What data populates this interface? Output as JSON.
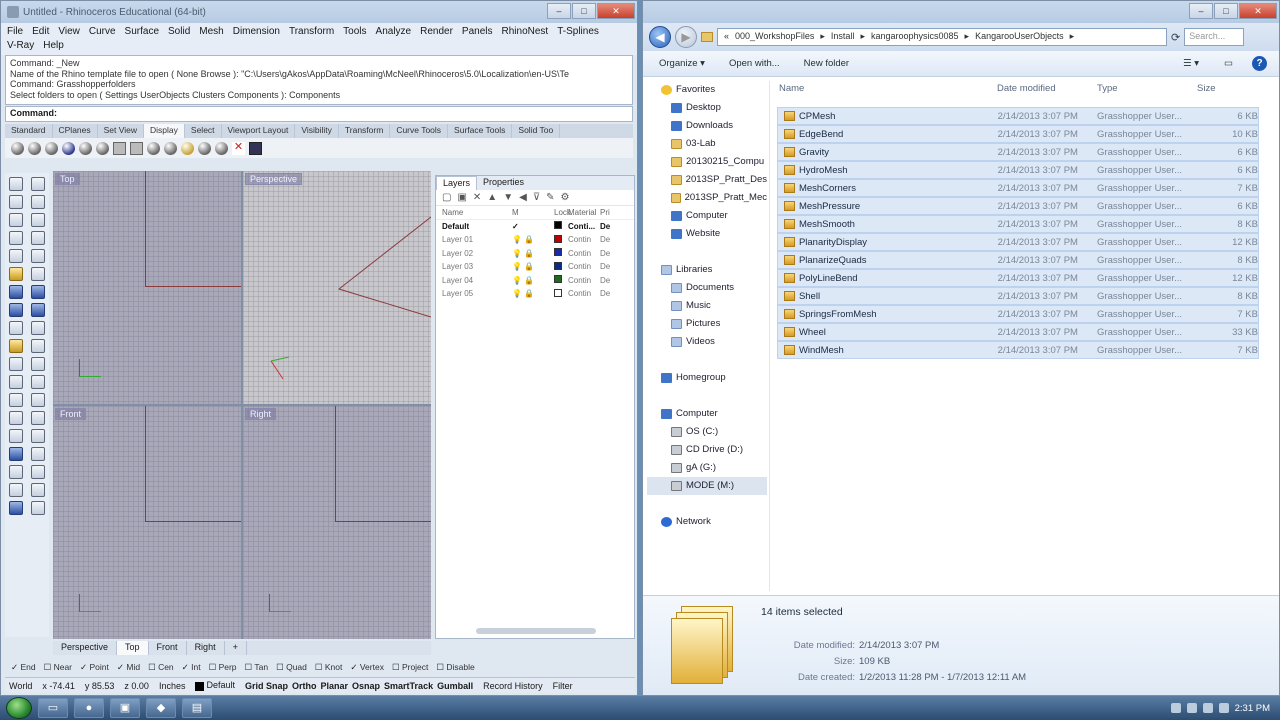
{
  "rhino": {
    "title": "Untitled - Rhinoceros Educational (64-bit)",
    "menu": [
      "File",
      "Edit",
      "View",
      "Curve",
      "Surface",
      "Solid",
      "Mesh",
      "Dimension",
      "Transform",
      "Tools",
      "Analyze",
      "Render",
      "Panels",
      "RhinoNest",
      "T-Splines",
      "V-Ray",
      "Help"
    ],
    "command_history": [
      "Command: _New",
      "Name of the Rhino template file to open ( None  Browse ): \"C:\\Users\\gAkos\\AppData\\Roaming\\McNeel\\Rhinoceros\\5.0\\Localization\\en-US\\Te",
      "Command: Grasshopperfolders",
      "Select folders to open ( Settings  UserObjects  Clusters  Components ): Components"
    ],
    "command_prompt": "Command:",
    "toolbar_tabs": [
      "Standard",
      "CPlanes",
      "Set View",
      "Display",
      "Select",
      "Viewport Layout",
      "Visibility",
      "Transform",
      "Curve Tools",
      "Surface Tools",
      "Solid Too"
    ],
    "active_toolbar_tab": "Display",
    "viewports": [
      {
        "label": "Top"
      },
      {
        "label": "Perspective"
      },
      {
        "label": "Front"
      },
      {
        "label": "Right"
      }
    ],
    "viewport_tabs": [
      "Perspective",
      "Top",
      "Front",
      "Right",
      "+"
    ],
    "layers_panel": {
      "tabs": [
        "Layers",
        "Properties"
      ],
      "headers": [
        "Name",
        "M",
        "Lock",
        "Material",
        "Pri"
      ],
      "rows": [
        {
          "name": "Default",
          "check": "✓",
          "color": "#000000",
          "material": "Conti...",
          "print": "De"
        },
        {
          "name": "Layer 01",
          "check": "",
          "color": "#c00000",
          "material": "Contin",
          "print": "De"
        },
        {
          "name": "Layer 02",
          "check": "",
          "color": "#1a2aa8",
          "material": "Contin",
          "print": "De"
        },
        {
          "name": "Layer 03",
          "check": "",
          "color": "#0a2a8a",
          "material": "Contin",
          "print": "De"
        },
        {
          "name": "Layer 04",
          "check": "",
          "color": "#1e6a1e",
          "material": "Contin",
          "print": "De"
        },
        {
          "name": "Layer 05",
          "check": "",
          "color": "#ffffff",
          "material": "Contin",
          "print": "De"
        }
      ]
    },
    "osnaps": [
      {
        "label": "End",
        "on": true
      },
      {
        "label": "Near",
        "on": false
      },
      {
        "label": "Point",
        "on": true
      },
      {
        "label": "Mid",
        "on": true
      },
      {
        "label": "Cen",
        "on": false
      },
      {
        "label": "Int",
        "on": true
      },
      {
        "label": "Perp",
        "on": false
      },
      {
        "label": "Tan",
        "on": false
      },
      {
        "label": "Quad",
        "on": false
      },
      {
        "label": "Knot",
        "on": false
      },
      {
        "label": "Vertex",
        "on": true
      },
      {
        "label": "Project",
        "on": false
      },
      {
        "label": "Disable",
        "on": false
      }
    ],
    "status": {
      "cplane": "World",
      "x": "x -74.41",
      "y": "y 85.53",
      "z": "z 0.00",
      "units": "Inches",
      "layer": "Default",
      "toggles": [
        "Grid Snap",
        "Ortho",
        "Planar",
        "Osnap",
        "SmartTrack",
        "Gumball"
      ],
      "history": "Record History",
      "filter": "Filter"
    }
  },
  "explorer": {
    "breadcrumb": [
      "000_WorkshopFiles",
      "Install",
      "kangaroophysics0085",
      "KangarooUserObjects"
    ],
    "search_placeholder": "Search...",
    "commands": [
      "Organize ▾",
      "Open with...",
      "New folder"
    ],
    "nav": {
      "favorites": [
        "Favorites",
        "Desktop",
        "Downloads",
        "03-Lab",
        "20130215_Compu",
        "2013SP_Pratt_Des",
        "2013SP_Pratt_Mec",
        "Computer",
        "Website"
      ],
      "libraries": [
        "Libraries",
        "Documents",
        "Music",
        "Pictures",
        "Videos"
      ],
      "homegroup": "Homegroup",
      "computer": [
        "Computer",
        "OS (C:)",
        "CD Drive (D:)",
        "gA (G:)",
        "MODE (M:)"
      ],
      "network": "Network"
    },
    "columns": [
      "Name",
      "Date modified",
      "Type",
      "Size"
    ],
    "files": [
      {
        "name": "CPMesh",
        "date": "2/14/2013 3:07 PM",
        "type": "Grasshopper User...",
        "size": "6 KB"
      },
      {
        "name": "EdgeBend",
        "date": "2/14/2013 3:07 PM",
        "type": "Grasshopper User...",
        "size": "10 KB"
      },
      {
        "name": "Gravity",
        "date": "2/14/2013 3:07 PM",
        "type": "Grasshopper User...",
        "size": "6 KB"
      },
      {
        "name": "HydroMesh",
        "date": "2/14/2013 3:07 PM",
        "type": "Grasshopper User...",
        "size": "6 KB"
      },
      {
        "name": "MeshCorners",
        "date": "2/14/2013 3:07 PM",
        "type": "Grasshopper User...",
        "size": "7 KB"
      },
      {
        "name": "MeshPressure",
        "date": "2/14/2013 3:07 PM",
        "type": "Grasshopper User...",
        "size": "6 KB"
      },
      {
        "name": "MeshSmooth",
        "date": "2/14/2013 3:07 PM",
        "type": "Grasshopper User...",
        "size": "8 KB"
      },
      {
        "name": "PlanarityDisplay",
        "date": "2/14/2013 3:07 PM",
        "type": "Grasshopper User...",
        "size": "12 KB"
      },
      {
        "name": "PlanarizeQuads",
        "date": "2/14/2013 3:07 PM",
        "type": "Grasshopper User...",
        "size": "8 KB"
      },
      {
        "name": "PolyLineBend",
        "date": "2/14/2013 3:07 PM",
        "type": "Grasshopper User...",
        "size": "12 KB"
      },
      {
        "name": "Shell",
        "date": "2/14/2013 3:07 PM",
        "type": "Grasshopper User...",
        "size": "8 KB"
      },
      {
        "name": "SpringsFromMesh",
        "date": "2/14/2013 3:07 PM",
        "type": "Grasshopper User...",
        "size": "7 KB"
      },
      {
        "name": "Wheel",
        "date": "2/14/2013 3:07 PM",
        "type": "Grasshopper User...",
        "size": "33 KB"
      },
      {
        "name": "WindMesh",
        "date": "2/14/2013 3:07 PM",
        "type": "Grasshopper User...",
        "size": "7 KB"
      }
    ],
    "details": {
      "count": "14 items selected",
      "date_modified_label": "Date modified:",
      "date_modified": "2/14/2013 3:07 PM",
      "size_label": "Size:",
      "size": "109 KB",
      "date_created_label": "Date created:",
      "date_created": "1/2/2013 11:28 PM - 1/7/2013 12:11 AM"
    }
  },
  "taskbar": {
    "clock": "2:31 PM"
  }
}
